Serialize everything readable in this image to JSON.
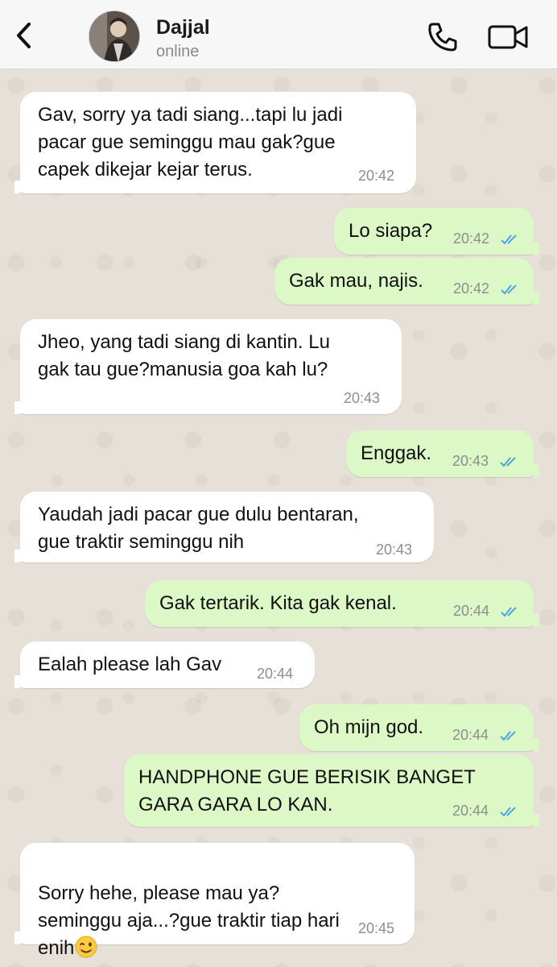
{
  "header": {
    "contact_name": "Dajjal",
    "status": "online",
    "icons": [
      "chevron-left-icon",
      "phone-icon",
      "video-camera-icon"
    ]
  },
  "colors": {
    "incoming_bubble": "#ffffff",
    "outgoing_bubble": "#dcf8c6",
    "read_ticks": "#4fa3e0",
    "timestamp": "#8d8d8d"
  },
  "messages": [
    {
      "dir": "in",
      "text": "Gav, sorry ya tadi siang...tapi lu jadi\npacar gue seminggu mau gak?gue\ncapek dikejar kejar terus.",
      "time": "20:42"
    },
    {
      "dir": "out",
      "text": "Lo siapa?",
      "time": "20:42",
      "read": true
    },
    {
      "dir": "out",
      "text": "Gak mau, najis.",
      "time": "20:42",
      "read": true
    },
    {
      "dir": "in",
      "text": "Jheo, yang tadi siang di kantin. Lu\ngak tau gue?manusia goa kah lu?",
      "time": "20:43"
    },
    {
      "dir": "out",
      "text": "Enggak.",
      "time": "20:43",
      "read": true
    },
    {
      "dir": "in",
      "text": "Yaudah jadi pacar gue dulu bentaran,\ngue traktir seminggu nih",
      "time": "20:43"
    },
    {
      "dir": "out",
      "text": "Gak tertarik. Kita gak kenal.",
      "time": "20:44",
      "read": true
    },
    {
      "dir": "in",
      "text": "Ealah please lah Gav",
      "time": "20:44"
    },
    {
      "dir": "out",
      "text": "Oh mijn god.",
      "time": "20:44",
      "read": true
    },
    {
      "dir": "out",
      "text": "HANDPHONE GUE BERISIK BANGET\nGARA GARA LO KAN.",
      "time": "20:44",
      "read": true
    },
    {
      "dir": "in",
      "text": "Sorry hehe, please mau ya?\nseminggu aja...?gue traktir tiap hari\nenih",
      "time": "20:45",
      "emoji": "winking-face-icon"
    }
  ]
}
